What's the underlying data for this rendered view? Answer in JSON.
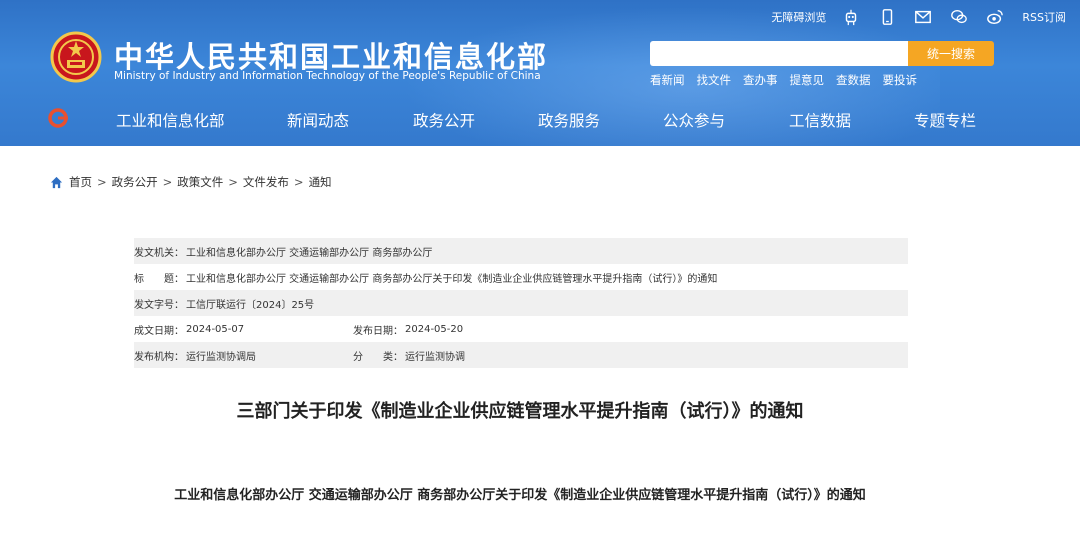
{
  "header": {
    "title": "中华人民共和国工业和信息化部",
    "subtitle": "Ministry of Industry and Information Technology of the People's Republic of China",
    "top_links": {
      "accessibility": "无障碍浏览",
      "rss": "RSS订阅"
    },
    "search": {
      "placeholder": "",
      "button": "统一搜索"
    },
    "quick_links": [
      "看新闻",
      "找文件",
      "查办事",
      "提意见",
      "查数据",
      "要投诉"
    ],
    "nav": [
      "工业和信息化部",
      "新闻动态",
      "政务公开",
      "政务服务",
      "公众参与",
      "工信数据",
      "专题专栏"
    ]
  },
  "breadcrumb": [
    "首页",
    "政务公开",
    "政策文件",
    "文件发布",
    "通知"
  ],
  "meta": {
    "issuer_label": "发文机关：",
    "issuer": "工业和信息化部办公厅 交通运输部办公厅 商务部办公厅",
    "title_label": "标　　题：",
    "title": "工业和信息化部办公厅 交通运输部办公厅 商务部办公厅关于印发《制造业企业供应链管理水平提升指南（试行）》的通知",
    "doc_no_label": "发文字号：",
    "doc_no": "工信厅联运行〔2024〕25号",
    "written_label": "成文日期：",
    "written": "2024-05-07",
    "published_label": "发布日期：",
    "published": "2024-05-20",
    "agency_label": "发布机构：",
    "agency": "运行监测协调局",
    "category_label": "分　　类：",
    "category": "运行监测协调"
  },
  "document": {
    "title": "三部门关于印发《制造业企业供应链管理水平提升指南（试行）》的通知",
    "subtitle": "工业和信息化部办公厅 交通运输部办公厅 商务部办公厅关于印发《制造业企业供应链管理水平提升指南（试行）》的通知"
  },
  "colors": {
    "header_blue": "#3479cd",
    "search_orange": "#f5a623",
    "meta_row_bg": "#f0f0f0"
  }
}
